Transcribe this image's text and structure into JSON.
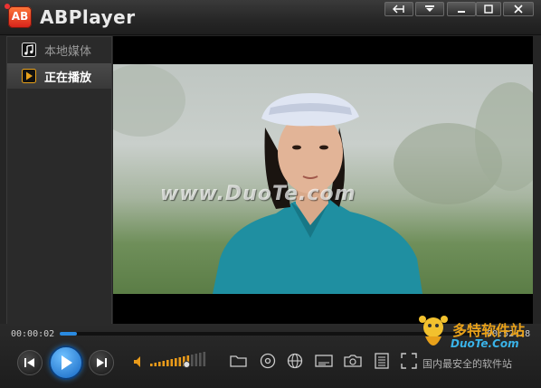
{
  "window": {
    "title": "ABPlayer",
    "logo_text": "AB"
  },
  "sidebar": {
    "items": [
      {
        "label": "本地媒体",
        "icon": "music-note-icon",
        "active": false
      },
      {
        "label": "正在播放",
        "icon": "play-square-icon",
        "active": true
      }
    ]
  },
  "video": {
    "watermark": "www.DuoTe.com"
  },
  "playback": {
    "elapsed": "00:00:02",
    "duration": "00:52:28",
    "progress": 0.04
  },
  "volume": {
    "level": 0.65
  },
  "toolbar": {
    "icons": [
      "open-folder-icon",
      "disc-icon",
      "globe-icon",
      "subtitle-icon",
      "snapshot-icon",
      "playlist-icon",
      "fullscreen-icon"
    ]
  },
  "brand": {
    "line1": "多特软件站",
    "line2": "DuoTe.Com",
    "line3": "国内最安全的软件站"
  },
  "colors": {
    "accent": "#2a8ae0",
    "volume": "#e89a1a",
    "logo": "#d6201a"
  }
}
